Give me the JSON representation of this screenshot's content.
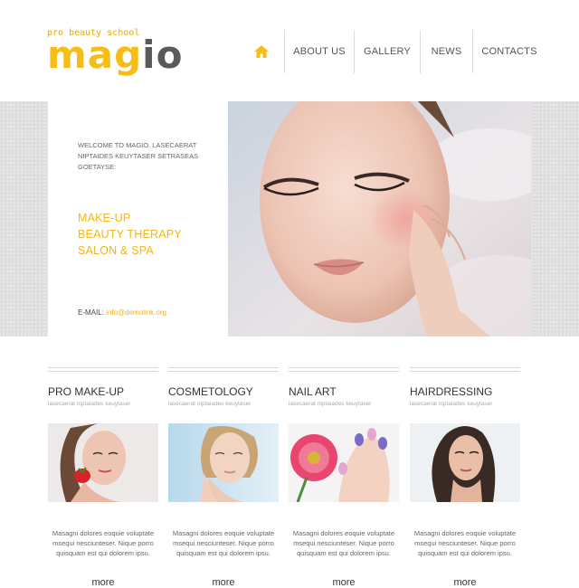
{
  "brand": {
    "tagline": "pro beauty school",
    "name_left": "mag",
    "name_right": "io"
  },
  "nav": {
    "home_icon": "home-icon",
    "items": [
      {
        "label": "ABOUT US"
      },
      {
        "label": "GALLERY"
      },
      {
        "label": "NEWS"
      },
      {
        "label": "CONTACTS"
      }
    ]
  },
  "hero": {
    "welcome": "WELCOME TO MAGIO. LASECAERAT NIPTAIDES KEUYTASER SETRASEAS GOETAYSE:",
    "services": [
      "MAKE-UP",
      "BEAUTY THERAPY",
      "SALON & SPA"
    ],
    "email_label": "E-MAIL:",
    "email_value": "info@demolink.org"
  },
  "columns": [
    {
      "title": "PRO MAKE-UP",
      "subtitle": "lasecaerat niptaiades keuytaser",
      "text": "Masagni dolores eoquie voluptate msequi nesciunteser. Nique porro quisquam est qui dolorem ipsu.",
      "more": "more"
    },
    {
      "title": "COSMETOLOGY",
      "subtitle": "lasecaerat niptaiades keuytaser",
      "text": "Masagni dolores eoquie voluptate msequi nesciunteser. Nique porro quisquam est qui dolorem ipsu.",
      "more": "more"
    },
    {
      "title": "NAIL ART",
      "subtitle": "lasecaerat niptaiades keuytaser",
      "text": "Masagni dolores eoquie voluptate msequi nesciunteser. Nique porro quisquam est qui dolorem ipsu.",
      "more": "more"
    },
    {
      "title": "HAIRDRESSING",
      "subtitle": "lasecaerat niptaiades keuytaser",
      "text": "Masagni dolores eoquie voluptate msequi nesciunteser. Nique porro quisquam est qui dolorem ipsu.",
      "more": "more"
    }
  ],
  "colors": {
    "accent": "#f2b51a",
    "logo_gray": "#5a5a5a"
  }
}
